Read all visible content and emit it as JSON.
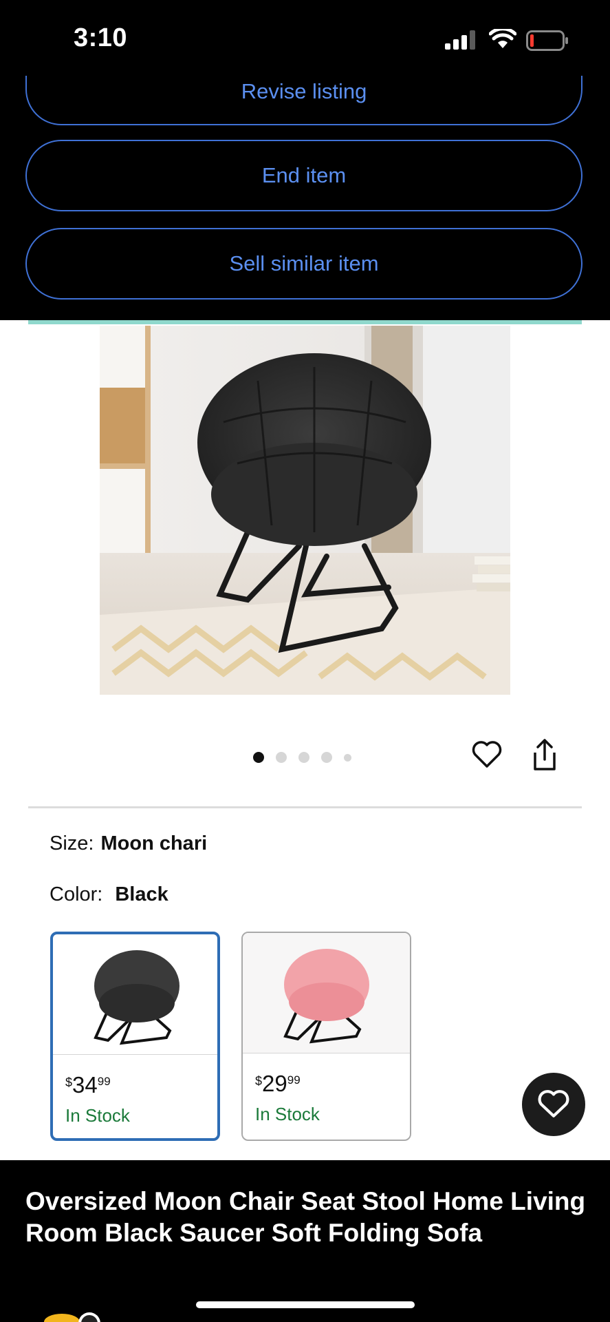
{
  "status_bar": {
    "time": "3:10"
  },
  "actions": {
    "revise": "Revise listing",
    "end": "End item",
    "sell_similar": "Sell similar item"
  },
  "gallery": {
    "dot_count": 5,
    "active_index": 0
  },
  "attributes": {
    "size_label": "Size:",
    "size_value": "Moon chari",
    "color_label": "Color:",
    "color_value": "Black"
  },
  "swatches": [
    {
      "currency": "$",
      "price_whole": "34",
      "price_cents": "99",
      "stock": "In Stock",
      "color": "#3a3a3a",
      "selected": true
    },
    {
      "currency": "$",
      "price_whole": "29",
      "price_cents": "99",
      "stock": "In Stock",
      "color": "#f2a3a9",
      "selected": false
    }
  ],
  "listing_title": "Oversized Moon Chair Seat Stool Home Living Room Black Saucer Soft Folding Sofa",
  "colors": {
    "accent_blue": "#5b8ff0",
    "selected_border": "#2e6db5",
    "stock_green": "#1b7a3a"
  }
}
